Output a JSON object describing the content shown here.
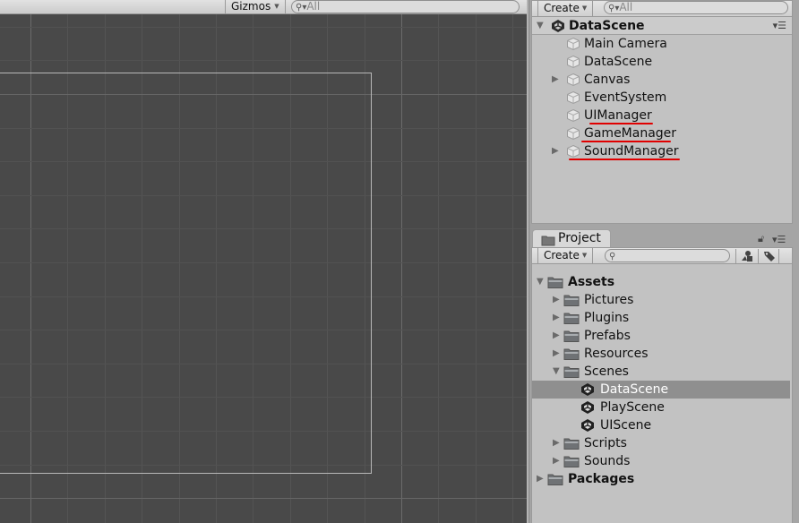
{
  "scene_view": {
    "gizmos_label": "Gizmos",
    "search_placeholder": "All"
  },
  "hierarchy": {
    "create_label": "Create",
    "search_placeholder": "All",
    "scene_name": "DataScene",
    "items": [
      {
        "label": "Main Camera",
        "expandable": false
      },
      {
        "label": "DataScene",
        "expandable": false
      },
      {
        "label": "Canvas",
        "expandable": true
      },
      {
        "label": "EventSystem",
        "expandable": false
      },
      {
        "label": "UIManager",
        "expandable": false,
        "annotated": true
      },
      {
        "label": "GameManager",
        "expandable": false,
        "annotated": true
      },
      {
        "label": "SoundManager",
        "expandable": true,
        "annotated": true
      }
    ]
  },
  "project": {
    "tab_label": "Project",
    "create_label": "Create",
    "search_value": "",
    "tree": [
      {
        "label": "Assets",
        "level": 0,
        "expanded": true,
        "type": "folder",
        "bold": true
      },
      {
        "label": "Pictures",
        "level": 1,
        "expanded": false,
        "type": "folder"
      },
      {
        "label": "Plugins",
        "level": 1,
        "expanded": false,
        "type": "folder"
      },
      {
        "label": "Prefabs",
        "level": 1,
        "expanded": false,
        "type": "folder"
      },
      {
        "label": "Resources",
        "level": 1,
        "expanded": false,
        "type": "folder"
      },
      {
        "label": "Scenes",
        "level": 1,
        "expanded": true,
        "type": "folder"
      },
      {
        "label": "DataScene",
        "level": 2,
        "type": "scene",
        "selected": true
      },
      {
        "label": "PlayScene",
        "level": 2,
        "type": "scene"
      },
      {
        "label": "UIScene",
        "level": 2,
        "type": "scene"
      },
      {
        "label": "Scripts",
        "level": 1,
        "expanded": false,
        "type": "folder"
      },
      {
        "label": "Sounds",
        "level": 1,
        "expanded": false,
        "type": "folder"
      },
      {
        "label": "Packages",
        "level": 0,
        "expanded": false,
        "type": "folder",
        "bold": true
      }
    ]
  },
  "colors": {
    "scene_bg": "#494949",
    "panel_bg": "#c2c2c2",
    "selection": "#8f8f8f",
    "annotation": "#e00000"
  }
}
